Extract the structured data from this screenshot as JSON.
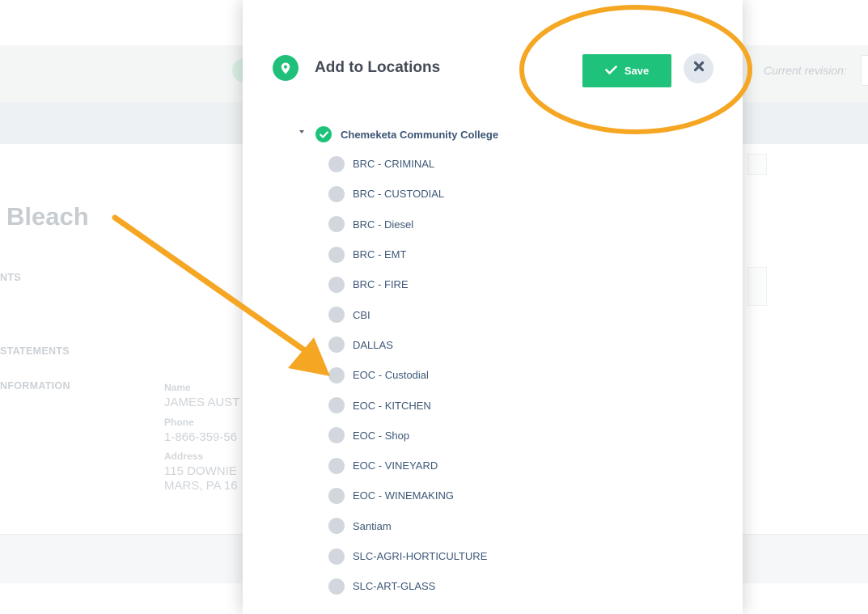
{
  "background": {
    "current_revision_label": "Current revision:",
    "product_title": "Bleach",
    "sections": [
      "NTS",
      "STATEMENTS",
      "NFORMATION"
    ],
    "contact": {
      "name_label": "Name",
      "name_value": "JAMES AUST",
      "phone_label": "Phone",
      "phone_value": "1-866-359-56",
      "address_label": "Address",
      "address_line1": "115 DOWNIE",
      "address_line2": "MARS, PA 16"
    }
  },
  "modal": {
    "title": "Add to Locations",
    "header_icon": "map-pin-icon",
    "save_label": "Save",
    "save_icon": "checkmark-icon",
    "close_icon": "close-x-icon",
    "tree": {
      "root_label": "Chemeketa Community College",
      "root_checked": true,
      "items": [
        "BRC - CRIMINAL",
        "BRC - CUSTODIAL",
        "BRC - Diesel",
        "BRC - EMT",
        "BRC - FIRE",
        "CBI",
        "DALLAS",
        "EOC - Custodial",
        "EOC - KITCHEN",
        "EOC - Shop",
        "EOC - VINEYARD",
        "EOC - WINEMAKING",
        "Santiam",
        "SLC-AGRI-HORTICULTURE",
        "SLC-ART-GLASS"
      ]
    }
  },
  "colors": {
    "accent_green": "#1ec27a",
    "annotation_orange": "#f5a623",
    "label_blue": "#3e5778",
    "radio_gray": "#d2d7dd"
  }
}
